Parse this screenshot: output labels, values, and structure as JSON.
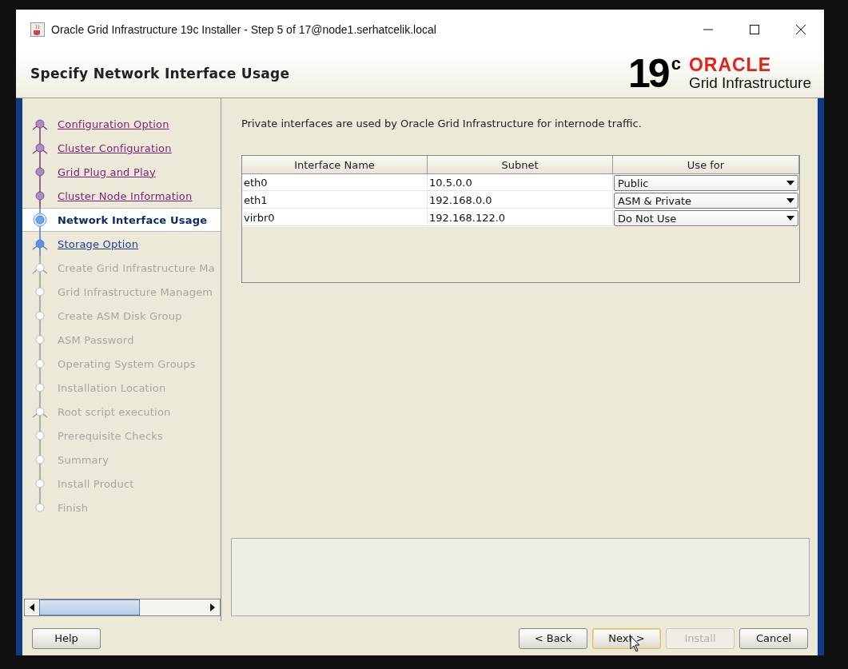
{
  "window": {
    "title": "Oracle Grid Infrastructure 19c Installer - Step 5 of 17@node1.serhatcelik.local"
  },
  "header": {
    "title": "Specify Network Interface Usage",
    "logo": {
      "version": "19",
      "superscript": "c",
      "brand": "ORACLE",
      "product": "Grid Infrastructure"
    }
  },
  "steps": [
    {
      "label": "Configuration Option",
      "visited": true,
      "selected": false,
      "disabled": false,
      "fork": true
    },
    {
      "label": "Cluster Configuration",
      "visited": true,
      "selected": false,
      "disabled": false,
      "fork": true
    },
    {
      "label": "Grid Plug and Play",
      "visited": true,
      "selected": false,
      "disabled": false,
      "fork": false
    },
    {
      "label": "Cluster Node Information",
      "visited": true,
      "selected": false,
      "disabled": false,
      "fork": false
    },
    {
      "label": "Network Interface Usage",
      "visited": false,
      "selected": true,
      "disabled": false,
      "fork": false
    },
    {
      "label": "Storage Option",
      "visited": false,
      "selected": false,
      "disabled": false,
      "fork": true
    },
    {
      "label": "Create Grid Infrastructure Ma",
      "visited": false,
      "selected": false,
      "disabled": true,
      "fork": true
    },
    {
      "label": "Grid Infrastructure Managem",
      "visited": false,
      "selected": false,
      "disabled": true,
      "fork": false
    },
    {
      "label": "Create ASM Disk Group",
      "visited": false,
      "selected": false,
      "disabled": true,
      "fork": false
    },
    {
      "label": "ASM Password",
      "visited": false,
      "selected": false,
      "disabled": true,
      "fork": false
    },
    {
      "label": "Operating System Groups",
      "visited": false,
      "selected": false,
      "disabled": true,
      "fork": false
    },
    {
      "label": "Installation Location",
      "visited": false,
      "selected": false,
      "disabled": true,
      "fork": false
    },
    {
      "label": "Root script execution",
      "visited": false,
      "selected": false,
      "disabled": true,
      "fork": true
    },
    {
      "label": "Prerequisite Checks",
      "visited": false,
      "selected": false,
      "disabled": true,
      "fork": false
    },
    {
      "label": "Summary",
      "visited": false,
      "selected": false,
      "disabled": true,
      "fork": false
    },
    {
      "label": "Install Product",
      "visited": false,
      "selected": false,
      "disabled": true,
      "fork": false
    },
    {
      "label": "Finish",
      "visited": false,
      "selected": false,
      "disabled": true,
      "fork": false
    }
  ],
  "intro": "Private interfaces are used by Oracle Grid Infrastructure for internode traffic.",
  "table": {
    "columns": [
      "Interface Name",
      "Subnet",
      "Use for"
    ],
    "rows": [
      {
        "name": "eth0",
        "subnet": "10.5.0.0",
        "use_for": "Public"
      },
      {
        "name": "eth1",
        "subnet": "192.168.0.0",
        "use_for": "ASM & Private"
      },
      {
        "name": "virbr0",
        "subnet": "192.168.122.0",
        "use_for": "Do Not Use"
      }
    ]
  },
  "help_button": {
    "label": "Help"
  },
  "buttons": [
    {
      "label": "< Back",
      "disabled": false,
      "focused": false
    },
    {
      "label": "Next >",
      "disabled": false,
      "focused": true
    },
    {
      "label": "Install",
      "disabled": true,
      "focused": false
    },
    {
      "label": "Cancel",
      "disabled": false,
      "focused": false
    }
  ]
}
